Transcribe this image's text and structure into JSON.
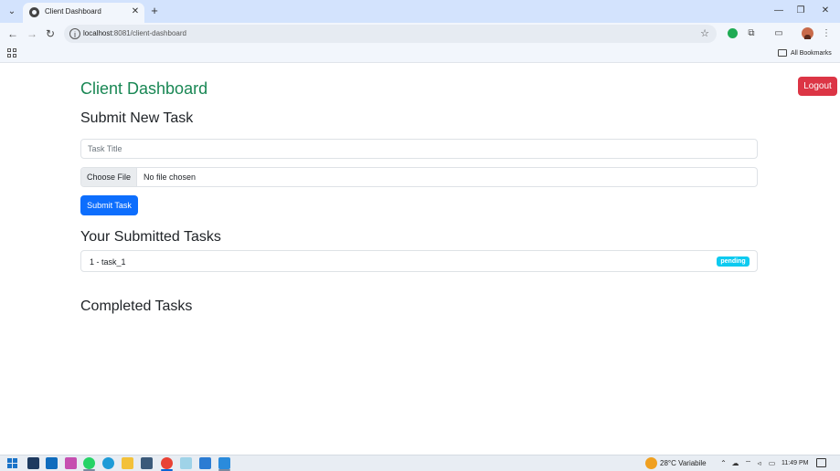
{
  "browser": {
    "tab_title": "Client Dashboard",
    "tab_close": "✕",
    "new_tab": "+",
    "tab_list": "⌄",
    "url_host": "localhost",
    "url_path": ":8081/client-dashboard",
    "back": "←",
    "forward": "→",
    "reload": "↻",
    "star": "☆",
    "window_controls": {
      "minimize": "—",
      "maximize": "❐",
      "close": "✕"
    },
    "bookmarks_label": "All Bookmarks"
  },
  "page": {
    "title": "Client Dashboard",
    "logout_label": "Logout",
    "submit_section_title": "Submit New Task",
    "task_title_placeholder": "Task Title",
    "choose_file_label": "Choose File",
    "file_status": "No file chosen",
    "submit_label": "Submit Task",
    "submitted_section_title": "Your Submitted Tasks",
    "submitted_tasks": [
      {
        "text": "1 - task_1",
        "status": "pending"
      }
    ],
    "completed_section_title": "Completed Tasks"
  },
  "taskbar": {
    "weather": "28°C  Variabile",
    "time": "11:49 PM",
    "colors": {
      "accent_green": "#198754",
      "logout_red": "#dc3545",
      "primary_blue": "#0d6efd",
      "badge_cyan": "#0dcaf0"
    }
  }
}
